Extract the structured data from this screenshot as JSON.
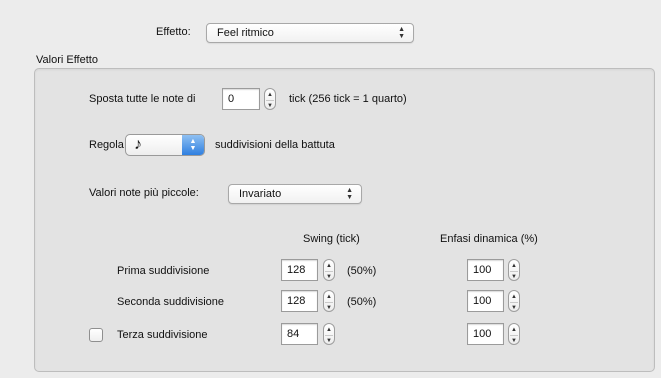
{
  "effetto": {
    "label": "Effetto:",
    "selected": "Feel ritmico"
  },
  "section_title": "Valori Effetto",
  "sposta": {
    "label": "Sposta tutte le note di",
    "value": "0",
    "suffix": "tick (256 tick = 1 quarto)"
  },
  "regola": {
    "label": "Regola",
    "note_symbol": "♪",
    "suffix": "suddivisioni della battuta"
  },
  "valori_note": {
    "label": "Valori note più piccole:",
    "selected": "Invariato"
  },
  "columns": {
    "swing": "Swing (tick)",
    "enfasi": "Enfasi dinamica (%)"
  },
  "rows": [
    {
      "label": "Prima suddivisione",
      "swing": "128",
      "percent": "(50%)",
      "enfasi": "100"
    },
    {
      "label": "Seconda suddivisione",
      "swing": "128",
      "percent": "(50%)",
      "enfasi": "100"
    },
    {
      "label": "Terza suddivisione",
      "swing": "84",
      "percent": "",
      "enfasi": "100",
      "checked": false
    }
  ]
}
